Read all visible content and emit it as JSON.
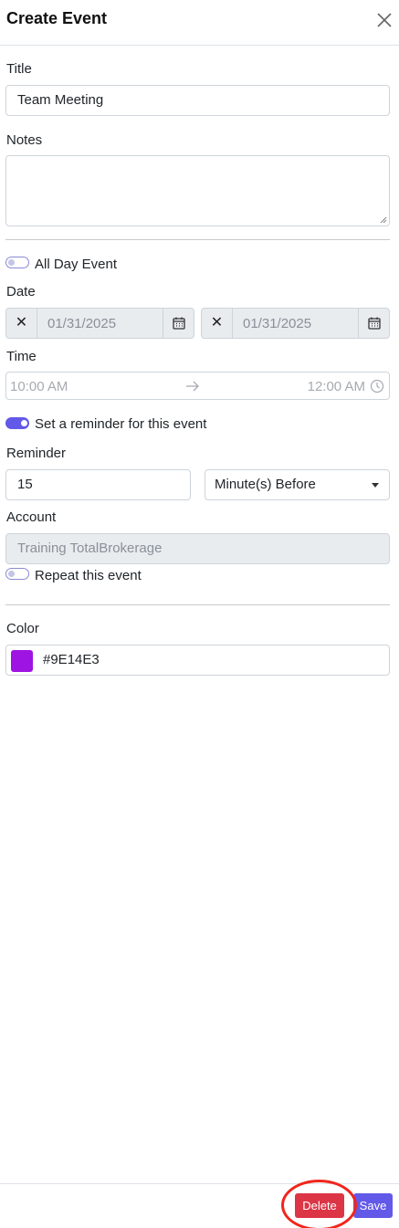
{
  "header": {
    "title": "Create Event"
  },
  "form": {
    "title_label": "Title",
    "title_value": "Team Meeting",
    "notes_label": "Notes",
    "notes_value": "",
    "all_day_label": "All Day Event",
    "all_day_on": false,
    "date_label": "Date",
    "date_start": "01/31/2025",
    "date_end": "01/31/2025",
    "clear_glyph": "✕",
    "time_label": "Time",
    "time_start": "10:00 AM",
    "time_end": "12:00 AM",
    "reminder_toggle_label": "Set a reminder for this event",
    "reminder_on": true,
    "reminder_label": "Reminder",
    "reminder_value": "15",
    "reminder_unit": "Minute(s) Before",
    "account_label": "Account",
    "account_value": "Training TotalBrokerage",
    "repeat_label": "Repeat this event",
    "repeat_on": false,
    "color_label": "Color",
    "color_value": "#9E14E3"
  },
  "footer": {
    "delete_label": "Delete",
    "save_label": "Save"
  },
  "colors": {
    "accent": "#6259e8",
    "danger": "#dc3545",
    "event_color": "#9E14E3",
    "annotation": "#f0261c"
  },
  "icons": [
    "close-icon",
    "calendar-icon",
    "arrow-right-icon",
    "clock-icon",
    "chevron-down-icon"
  ]
}
